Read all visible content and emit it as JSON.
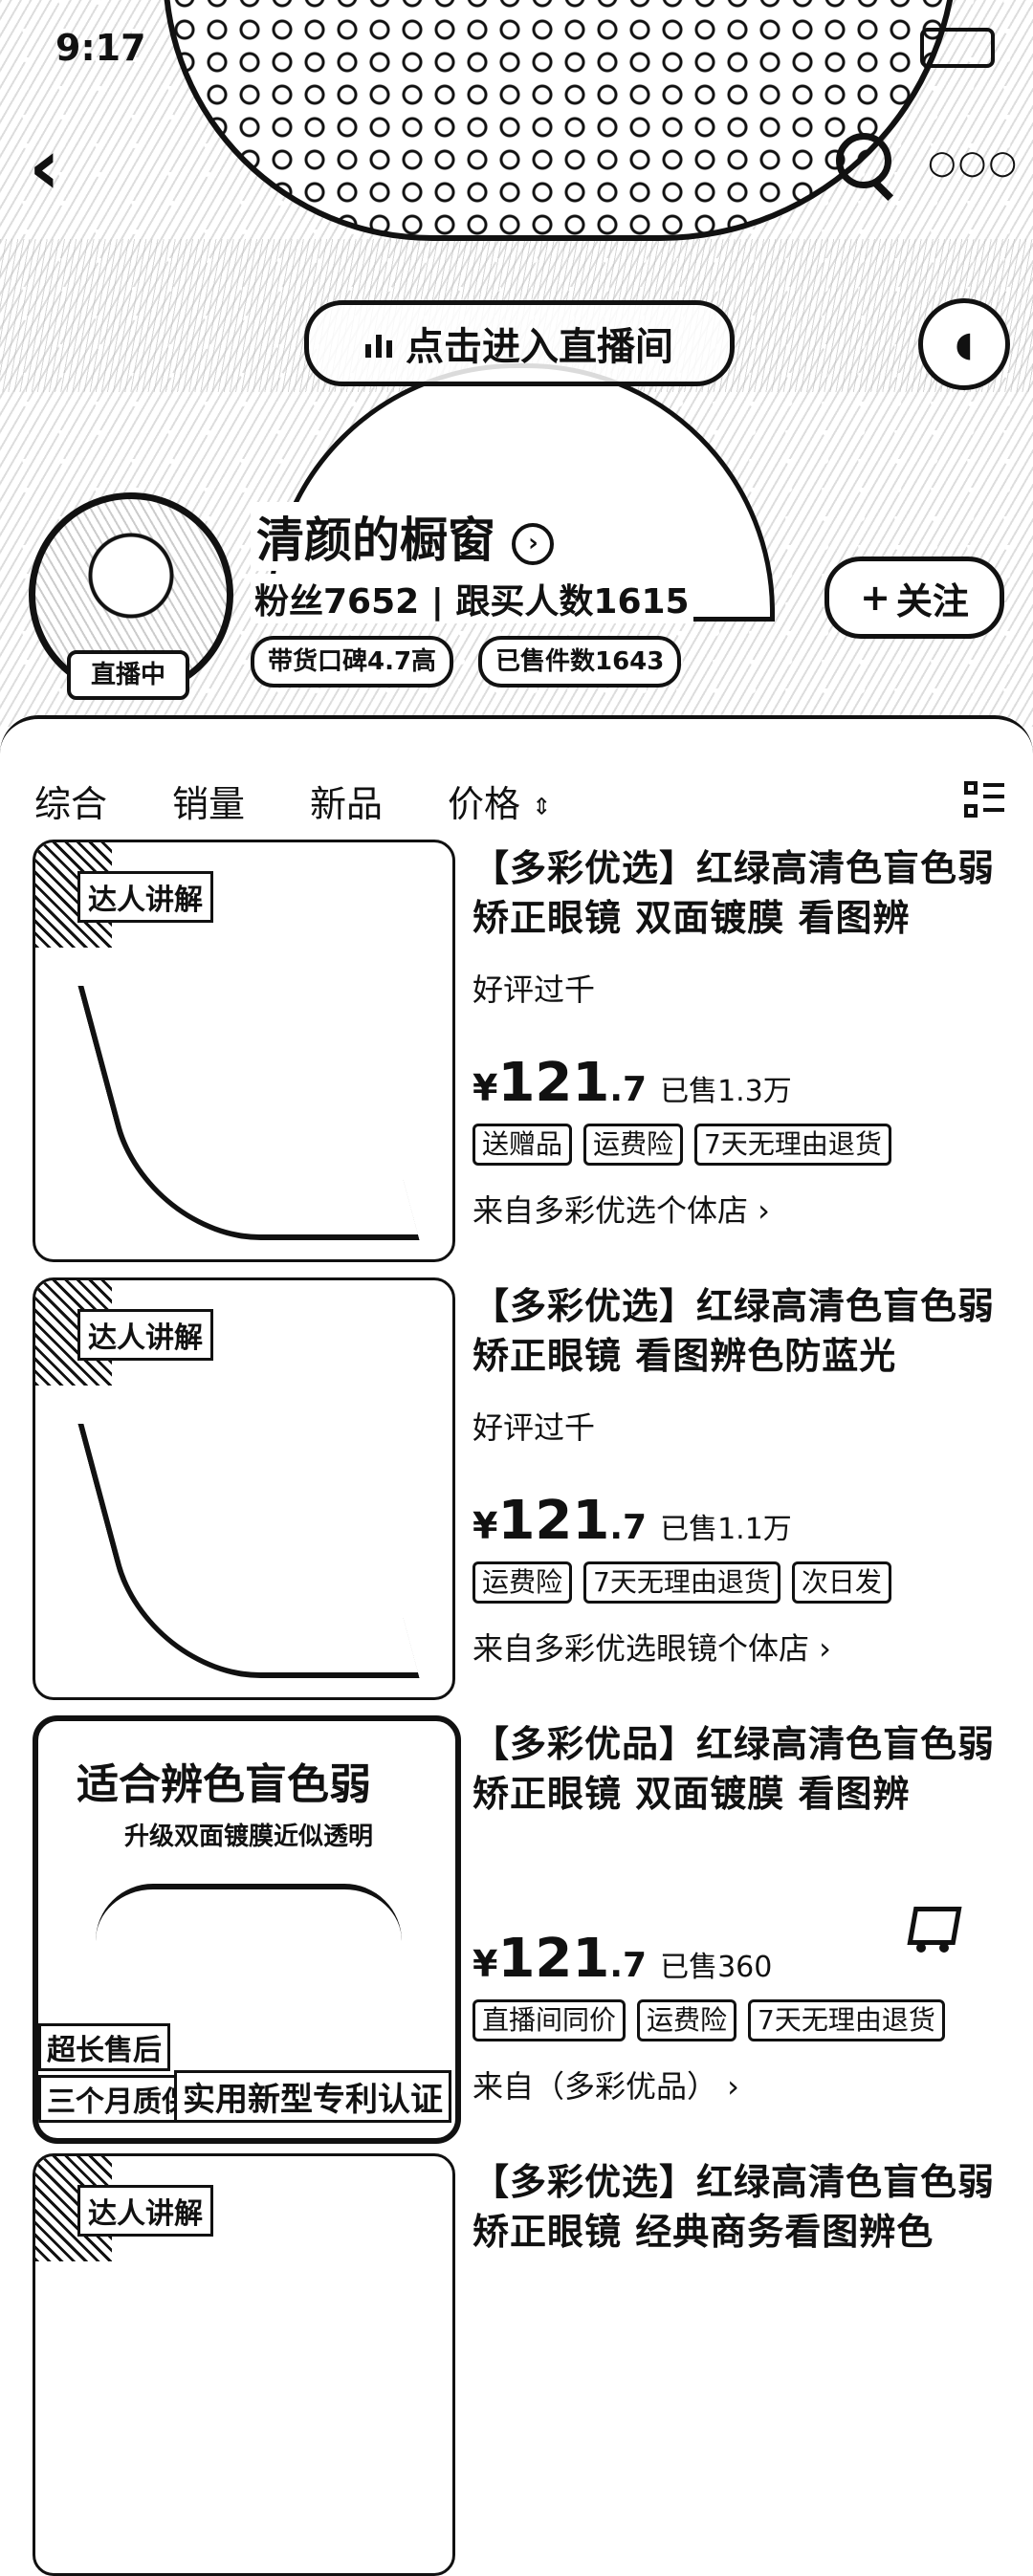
{
  "status_bar": {
    "time": "9:17"
  },
  "header": {
    "enter_live": "点击进入直播间",
    "live_badge": "直播中",
    "shop_name": "清颜的橱窗",
    "stats": "粉丝7652 | 跟买人数1615",
    "chips": [
      "带货口碑4.7高",
      "已售件数1643"
    ],
    "follow_label": "关注"
  },
  "filters": {
    "items": [
      "综合",
      "销量",
      "新品",
      "价格"
    ]
  },
  "products": [
    {
      "title": "【多彩优选】红绿高清色盲色弱矫正眼镜 双面镀膜 看图辨",
      "note": "好评过千",
      "price_cur": "¥",
      "price_int": "121",
      "price_dec": ".7",
      "sold": "已售1.3万",
      "tags": [
        "送赠品",
        "运费险",
        "7天无理由退货"
      ],
      "store": "来自多彩优选个体店 ›",
      "thumb_tag": "达人讲解"
    },
    {
      "title": "【多彩优选】红绿高清色盲色弱矫正眼镜 看图辨色防蓝光",
      "note": "好评过千",
      "price_cur": "¥",
      "price_int": "121",
      "price_dec": ".7",
      "sold": "已售1.1万",
      "tags": [
        "运费险",
        "7天无理由退货",
        "次日发"
      ],
      "store": "来自多彩优选眼镜个体店 ›",
      "thumb_tag": "达人讲解"
    },
    {
      "title": "【多彩优品】红绿高清色盲色弱矫正眼镜 双面镀膜 看图辨",
      "note": "",
      "price_cur": "¥",
      "price_int": "121",
      "price_dec": ".7",
      "sold": "已售360",
      "tags": [
        "直播间同价",
        "运费险",
        "7天无理由退货"
      ],
      "store": "来自（多彩优品） ›",
      "thumb_big": "适合辨色盲色弱",
      "thumb_sub": "升级双面镀膜近似透明",
      "thumb_badge1": "超长售后",
      "thumb_badge2": "三个月质保",
      "thumb_badge3": "实用新型专利认证"
    },
    {
      "title": "【多彩优选】红绿高清色盲色弱矫正眼镜 经典商务看图辨色",
      "thumb_tag": "达人讲解"
    }
  ]
}
